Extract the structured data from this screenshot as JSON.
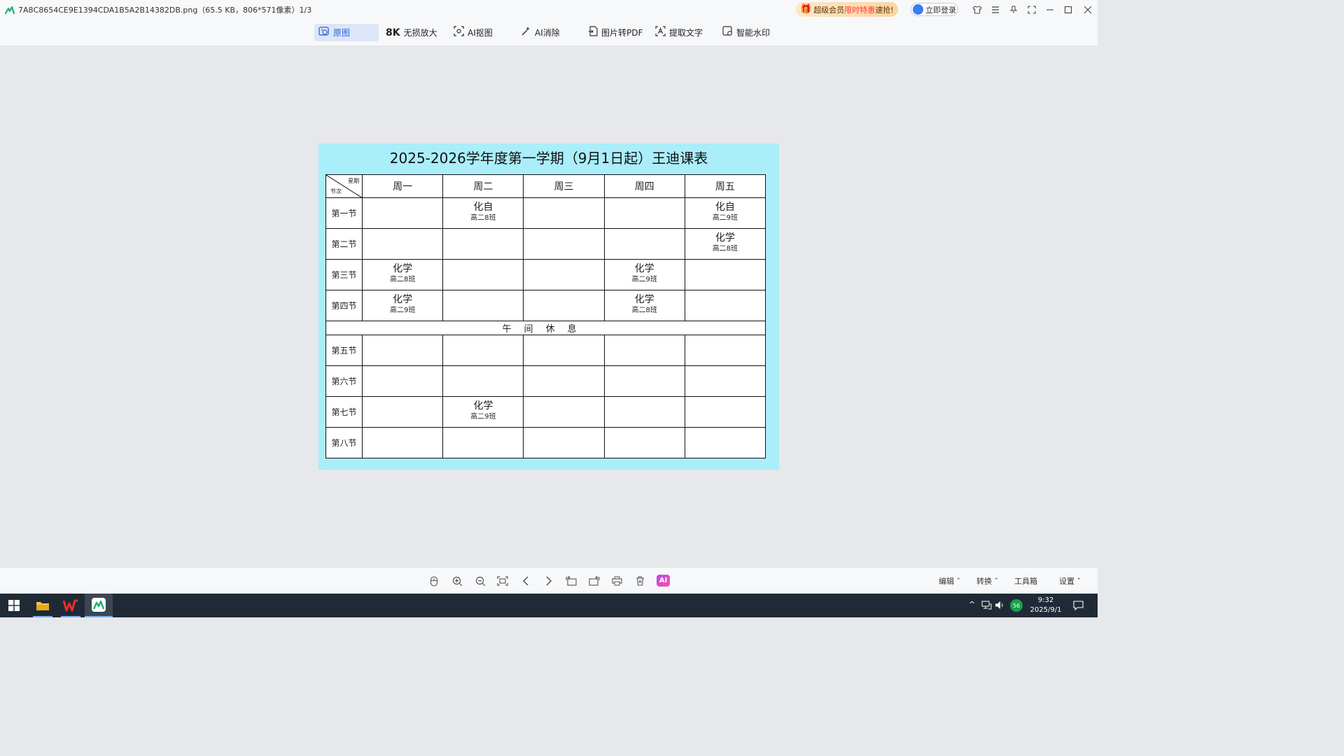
{
  "window": {
    "title": "7A8C8654CE9E1394CDA1B5A2B14382DB.png（65.5 KB，806*571像素）1/3",
    "promo_prefix": "超级会员",
    "promo_highlight": "限时特惠",
    "promo_suffix": "速抢!",
    "login_label": "立即登录"
  },
  "toolbar": {
    "items": [
      {
        "label": "原图",
        "icon": "image-eye-icon"
      },
      {
        "label": "无损放大",
        "icon": "8k-icon"
      },
      {
        "label": "AI抠图",
        "icon": "ai-cutout-icon"
      },
      {
        "label": "AI消除",
        "icon": "magic-wand-icon"
      },
      {
        "label": "图片转PDF",
        "icon": "pdf-convert-icon"
      },
      {
        "label": "提取文字",
        "icon": "text-extract-icon"
      },
      {
        "label": "智能水印",
        "icon": "watermark-icon"
      }
    ],
    "badge_8k": "8K"
  },
  "timetable": {
    "title": "2025-2026学年度第一学期（9月1日起）王迪课表",
    "corner_top": "星期",
    "corner_bottom": "节次",
    "days": [
      "周一",
      "周二",
      "周三",
      "周四",
      "周五"
    ],
    "lunch_label": "午间休息",
    "periods_morning": [
      {
        "name": "第一节",
        "cells": [
          null,
          {
            "subject": "化自",
            "class": "高二8班"
          },
          null,
          null,
          {
            "subject": "化自",
            "class": "高二9班"
          }
        ]
      },
      {
        "name": "第二节",
        "cells": [
          null,
          null,
          null,
          null,
          {
            "subject": "化学",
            "class": "高二8班"
          }
        ]
      },
      {
        "name": "第三节",
        "cells": [
          {
            "subject": "化学",
            "class": "高二8班"
          },
          null,
          null,
          {
            "subject": "化学",
            "class": "高二9班"
          },
          null
        ]
      },
      {
        "name": "第四节",
        "cells": [
          {
            "subject": "化学",
            "class": "高二9班"
          },
          null,
          null,
          {
            "subject": "化学",
            "class": "高二8班"
          },
          null
        ]
      }
    ],
    "periods_afternoon": [
      {
        "name": "第五节",
        "cells": [
          null,
          null,
          null,
          null,
          null
        ]
      },
      {
        "name": "第六节",
        "cells": [
          null,
          null,
          null,
          null,
          null
        ]
      },
      {
        "name": "第七节",
        "cells": [
          null,
          {
            "subject": "化学",
            "class": "高二9班"
          },
          null,
          null,
          null
        ]
      },
      {
        "name": "第八节",
        "cells": [
          null,
          null,
          null,
          null,
          null
        ]
      }
    ]
  },
  "bottombar": {
    "ai_label": "AI",
    "menus": [
      "编辑",
      "转换",
      "工具箱",
      "设置"
    ]
  },
  "taskbar": {
    "time": "9:32",
    "date": "2025/9/1",
    "badge": "56"
  },
  "colors": {
    "image_background": "#aaeefa",
    "active_tool": "#2b5fd9",
    "taskbar": "#1f2a36"
  }
}
